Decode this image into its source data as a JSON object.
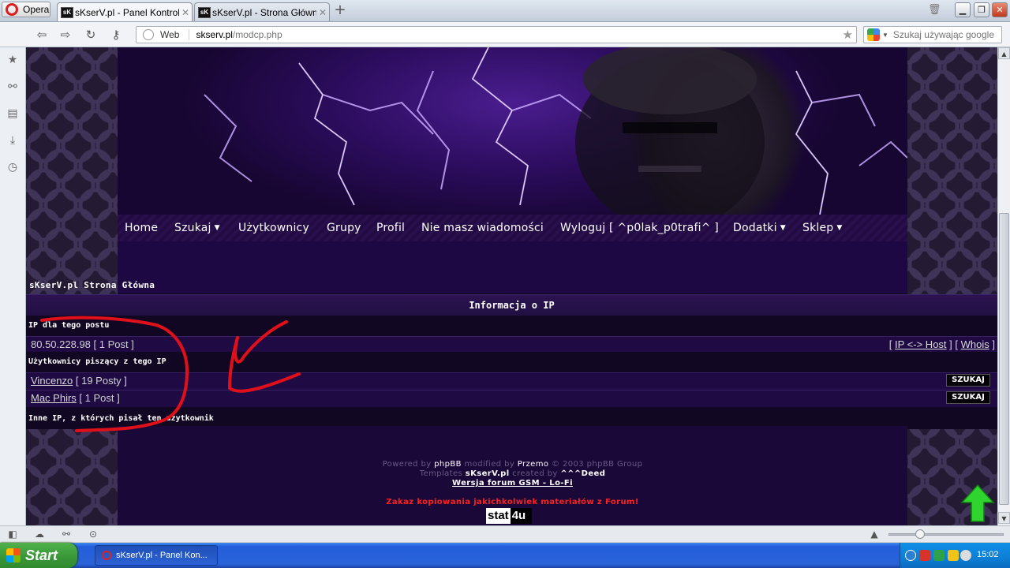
{
  "browser": {
    "menu_button": "Opera",
    "tabs": [
      {
        "favicon": "sK",
        "title": "sKserV.pl - Panel Kontrol...",
        "active": true
      },
      {
        "favicon": "sK",
        "title": "sKserV.pl - Strona Główn...",
        "active": false
      }
    ],
    "new_tab": "+",
    "address": {
      "label": "Web",
      "host": "skserv.pl",
      "path": "/modcp.php"
    },
    "search_placeholder": "Szukaj używając google"
  },
  "site": {
    "menu": [
      {
        "label": "Home",
        "dropdown": false
      },
      {
        "label": "Szukaj",
        "dropdown": true
      },
      {
        "label": "Użytkownicy",
        "dropdown": false
      },
      {
        "label": "Grupy",
        "dropdown": false
      },
      {
        "label": "Profil",
        "dropdown": false
      },
      {
        "label": "Nie masz wiadomości",
        "dropdown": false
      },
      {
        "label": "Wyloguj [ ^p0lak_p0trafi^ ]",
        "dropdown": false
      },
      {
        "label": "Dodatki",
        "dropdown": true
      },
      {
        "label": "Sklep",
        "dropdown": true
      }
    ],
    "breadcrumb": "sKserV.pl Strona Główna"
  },
  "ip_info": {
    "header": "Informacja o IP",
    "post_ip_label": "IP dla tego postu",
    "ip": "80.50.228.98",
    "ip_count": "[ 1 Post ]",
    "links": {
      "open": "[",
      "host": "IP <-> Host",
      "mid": "]  [",
      "whois": "Whois",
      "close": "]"
    },
    "users_label": "Użytkownicy piszący z tego IP",
    "users": [
      {
        "name": "Vincenzo",
        "count": "[ 19 Posty ]",
        "button": "SZUKAJ"
      },
      {
        "name": "Mac Phirs",
        "count": "[ 1 Post ]",
        "button": "SZUKAJ"
      }
    ],
    "other_ips_label": "Inne IP, z których pisał ten użytkownik"
  },
  "footer": {
    "powered": "Powered by",
    "phpbb": "phpBB",
    "modified": "modified by",
    "przemo": "Przemo",
    "copyright": "© 2003 phpBB Group",
    "templates": "Templates",
    "skserv": "sKserV.pl",
    "created": "created by",
    "deed": "^^^Deed",
    "version_link": "Wersja forum GSM - Lo-Fi",
    "warning": "Zakaz kopiowania jakichkolwiek materiałów z Forum!",
    "stat_a": "stat",
    "stat_b": "4u"
  },
  "taskbar": {
    "start": "Start",
    "task": "sKserV.pl - Panel Kon...",
    "clock": "15:02"
  },
  "colors": {
    "accent_purple": "#2a0f4d",
    "annotation_red": "#e0101a",
    "warning_red": "#ff2020"
  }
}
